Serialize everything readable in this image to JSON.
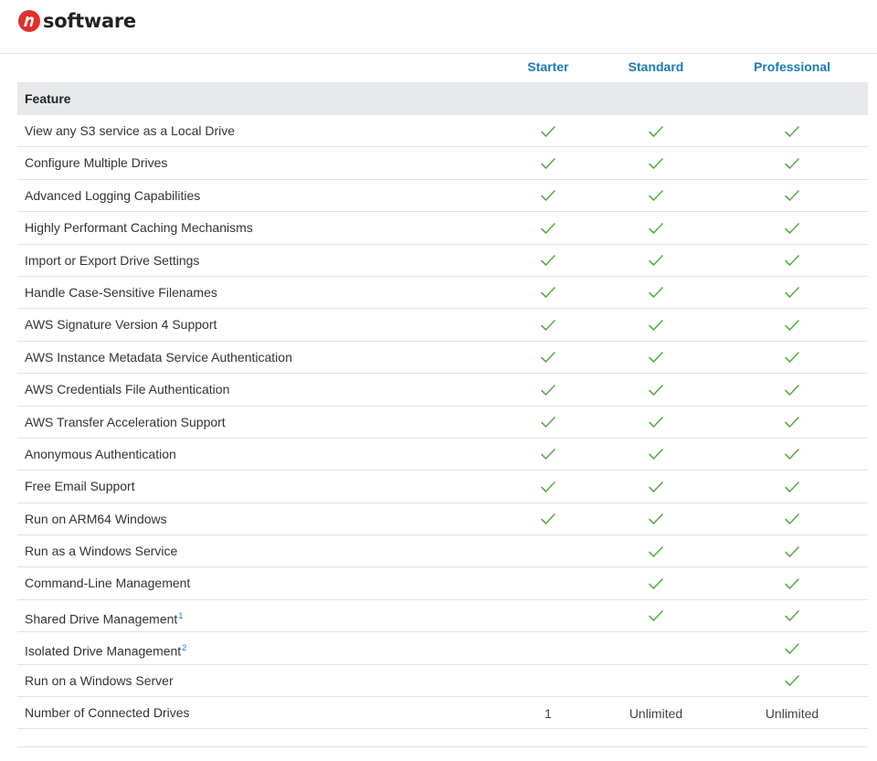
{
  "brand": {
    "name": "software",
    "accent": "#e0322b"
  },
  "plans": [
    "Starter",
    "Standard",
    "Professional"
  ],
  "feature_header": "Feature",
  "check_color": "#5aad4a",
  "link_color": "#1a7bb9",
  "rows": [
    {
      "name": "View any S3 service as a Local Drive",
      "sup": "",
      "values": [
        "check",
        "check",
        "check"
      ]
    },
    {
      "name": "Configure Multiple Drives",
      "sup": "",
      "values": [
        "check",
        "check",
        "check"
      ]
    },
    {
      "name": "Advanced Logging Capabilities",
      "sup": "",
      "values": [
        "check",
        "check",
        "check"
      ]
    },
    {
      "name": "Highly Performant Caching Mechanisms",
      "sup": "",
      "values": [
        "check",
        "check",
        "check"
      ]
    },
    {
      "name": "Import or Export Drive Settings",
      "sup": "",
      "values": [
        "check",
        "check",
        "check"
      ]
    },
    {
      "name": "Handle Case-Sensitive Filenames",
      "sup": "",
      "values": [
        "check",
        "check",
        "check"
      ]
    },
    {
      "name": "AWS Signature Version 4 Support",
      "sup": "",
      "values": [
        "check",
        "check",
        "check"
      ]
    },
    {
      "name": "AWS Instance Metadata Service Authentication",
      "sup": "",
      "values": [
        "check",
        "check",
        "check"
      ]
    },
    {
      "name": "AWS Credentials File Authentication",
      "sup": "",
      "values": [
        "check",
        "check",
        "check"
      ]
    },
    {
      "name": "AWS Transfer Acceleration Support",
      "sup": "",
      "values": [
        "check",
        "check",
        "check"
      ]
    },
    {
      "name": "Anonymous Authentication",
      "sup": "",
      "values": [
        "check",
        "check",
        "check"
      ]
    },
    {
      "name": "Free Email Support",
      "sup": "",
      "values": [
        "check",
        "check",
        "check"
      ]
    },
    {
      "name": "Run on ARM64 Windows",
      "sup": "",
      "values": [
        "check",
        "check",
        "check"
      ]
    },
    {
      "name": "Run as a Windows Service",
      "sup": "",
      "values": [
        "",
        "check",
        "check"
      ]
    },
    {
      "name": "Command-Line Management",
      "sup": "",
      "values": [
        "",
        "check",
        "check"
      ]
    },
    {
      "name": "Shared Drive Management",
      "sup": "1",
      "values": [
        "",
        "check",
        "check"
      ]
    },
    {
      "name": "Isolated Drive Management",
      "sup": "2",
      "values": [
        "",
        "",
        "check"
      ]
    },
    {
      "name": "Run on a Windows Server",
      "sup": "",
      "values": [
        "",
        "",
        "check"
      ]
    },
    {
      "name": "Number of Connected Drives",
      "sup": "",
      "values": [
        "1",
        "Unlimited",
        "Unlimited"
      ]
    }
  ]
}
